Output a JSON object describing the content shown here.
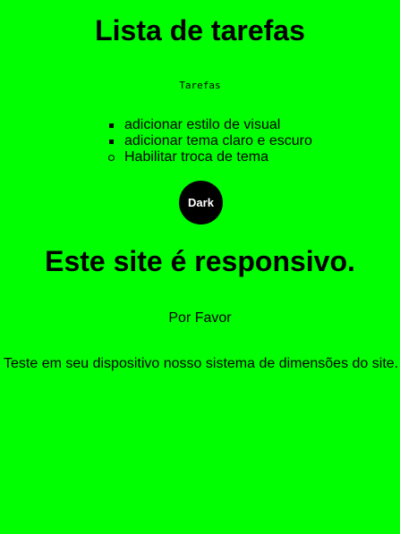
{
  "header": {
    "title": "Lista de tarefas"
  },
  "tasks": {
    "label": "Tarefas",
    "items": [
      {
        "text": "adicionar estilo de visual",
        "bullet": "square"
      },
      {
        "text": "adicionar tema claro e escuro",
        "bullet": "square"
      },
      {
        "text": "Habilitar troca de tema",
        "bullet": "circle"
      }
    ]
  },
  "theme_toggle": {
    "label": "Dark"
  },
  "responsive": {
    "heading": "Este site é responsivo.",
    "please": "Por Favor",
    "message": "Teste em seu dispositivo nosso sistema de dimensões do site."
  },
  "colors": {
    "background": "#00ff00",
    "text": "#000000",
    "button_bg": "#000000",
    "button_text": "#ffffff"
  }
}
